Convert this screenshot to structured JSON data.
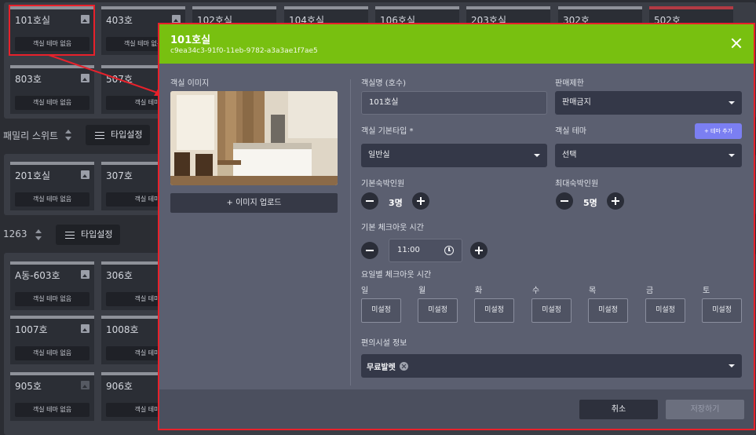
{
  "background": {
    "row1": [
      "101호실",
      "403호",
      "102호실",
      "104호실",
      "106호실",
      "203호실",
      "302호",
      "502호"
    ],
    "section_family": {
      "label": "패밀리 스위트",
      "type_button": "타입설정"
    },
    "row2": [
      "201호실",
      "307호"
    ],
    "section_1263": {
      "label": "1263",
      "type_button": "타입설정"
    },
    "row3": [
      "A동-603호",
      "306호"
    ],
    "row4": [
      "1007호",
      "1008호"
    ],
    "row5": [
      "905호",
      "906호"
    ],
    "room_row0": [
      "803호",
      "507호"
    ],
    "no_theme": "객실 테마 없음",
    "no_theme_cut": "객실 테마 없",
    "no_theme_cut2": "객실 테마 없음"
  },
  "modal": {
    "title": "101호실",
    "id": "c9ea34c3-91f0-11eb-9782-a3a3ae1f7ae5",
    "image_label": "객실 이미지",
    "upload_button": "+ 이미지 업로드",
    "room_name_label": "객실명 (호수)",
    "room_name_value": "101호실",
    "sales_limit_label": "판매제한",
    "sales_limit_value": "판매금지",
    "base_type_label": "객실 기본타입 *",
    "base_type_value": "일반실",
    "theme_label": "객실 테마",
    "add_theme_button": "+ 테마 추가",
    "theme_value": "선택",
    "base_guests_label": "기본숙박인원",
    "base_guests_value": "3명",
    "max_guests_label": "최대숙박인원",
    "max_guests_value": "5명",
    "checkout_label": "기본 체크아웃 시간",
    "checkout_value": "11:00",
    "weekday_checkout_label": "요일별 체크아웃 시간",
    "days": [
      {
        "name": "일",
        "value": "미설정"
      },
      {
        "name": "월",
        "value": "미설정"
      },
      {
        "name": "화",
        "value": "미설정"
      },
      {
        "name": "수",
        "value": "미설정"
      },
      {
        "name": "목",
        "value": "미설정"
      },
      {
        "name": "금",
        "value": "미설정"
      },
      {
        "name": "토",
        "value": "미설정"
      }
    ],
    "amenities_label": "편의시설 정보",
    "amenity_chip": "무료발렛",
    "cancel_button": "취소",
    "save_button": "저장하기"
  },
  "colors": {
    "header": "#78c010",
    "modal_bg": "#5b5f70",
    "accent": "#7b7ff2",
    "annotation": "#e8212b"
  }
}
